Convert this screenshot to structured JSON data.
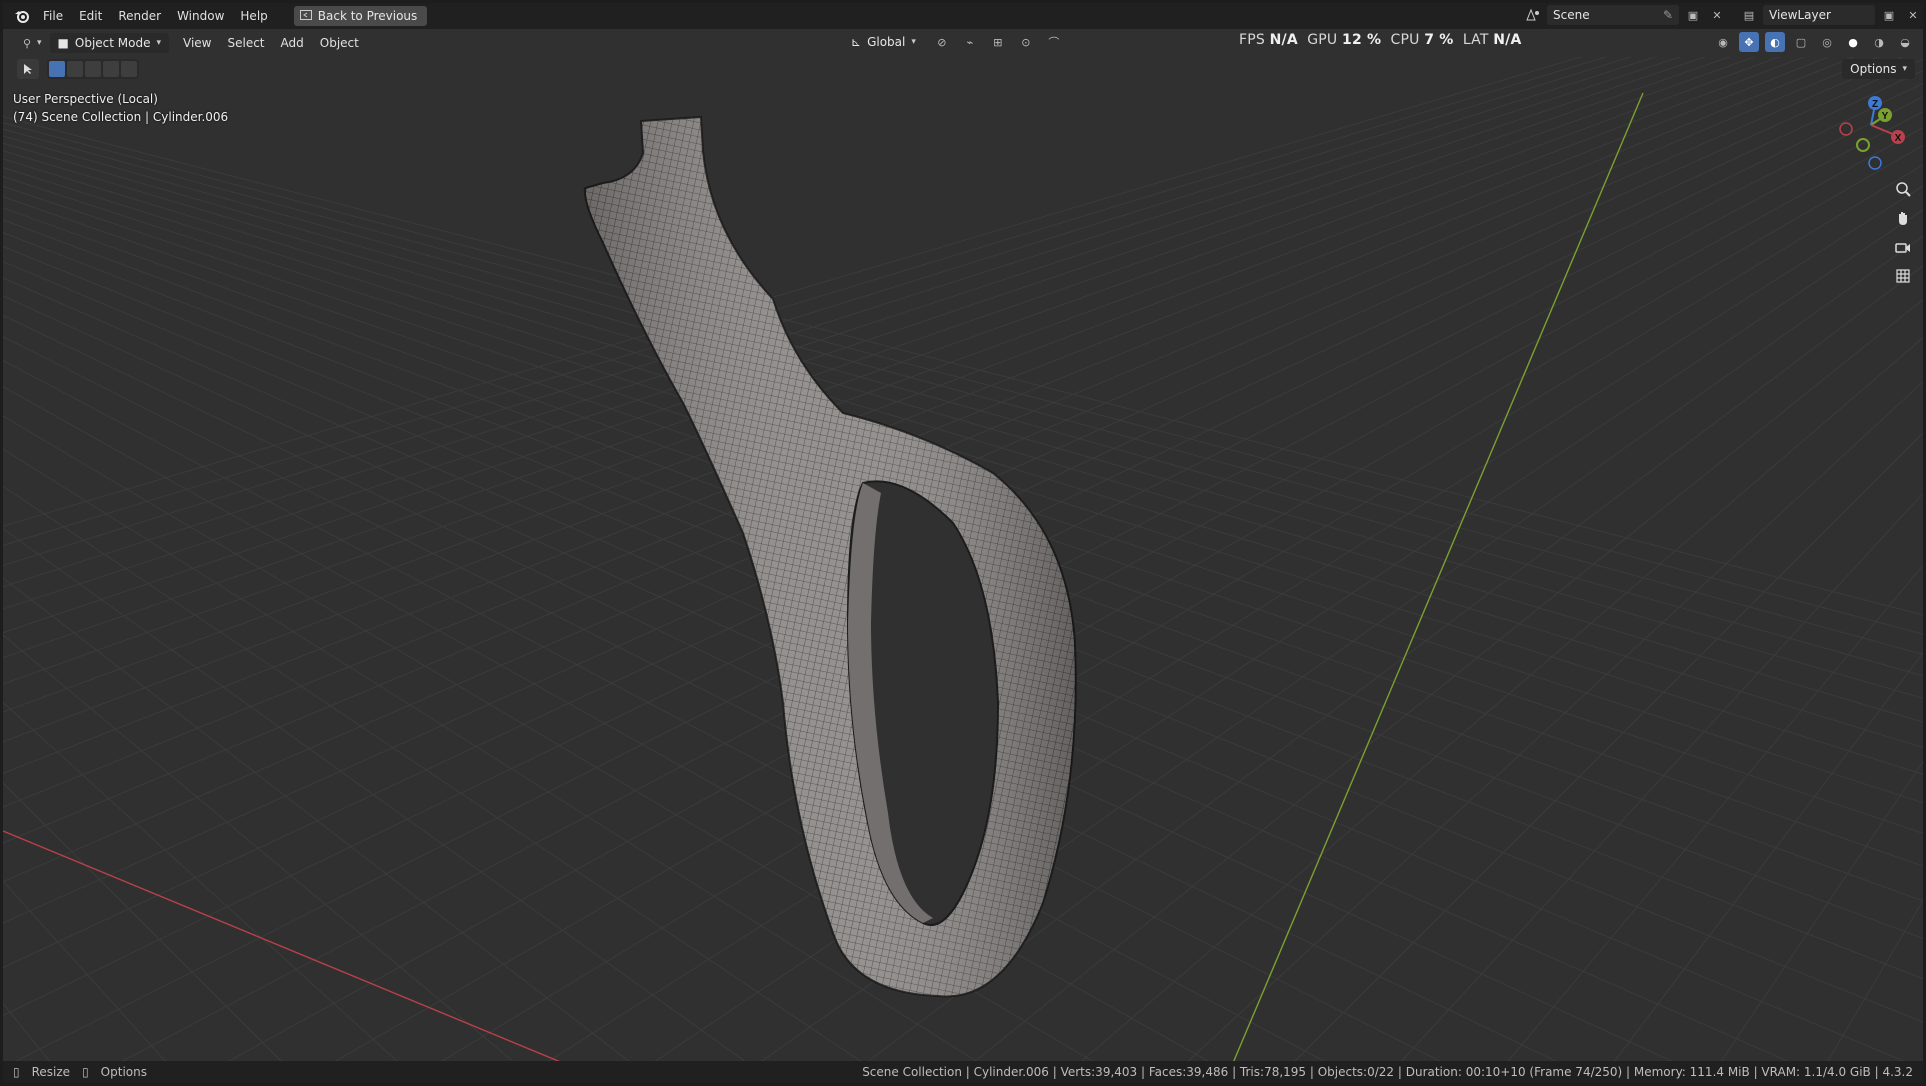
{
  "top_menu": {
    "file": "File",
    "edit": "Edit",
    "render": "Render",
    "window": "Window",
    "help": "Help"
  },
  "back_button": "Back to Previous",
  "scene": {
    "label": "Scene"
  },
  "view_layer": {
    "label": "ViewLayer"
  },
  "viewport_header": {
    "mode": "Object Mode",
    "view": "View",
    "select": "Select",
    "add": "Add",
    "object": "Object",
    "transform_orientation": "Global"
  },
  "stats": {
    "fps_label": "FPS",
    "fps_value": "N/A",
    "gpu_label": "GPU",
    "gpu_value": "12 %",
    "cpu_label": "CPU",
    "cpu_value": "7 %",
    "lat_label": "LAT",
    "lat_value": "N/A"
  },
  "options_label": "Options",
  "viewport_overlay": {
    "perspective": "User Perspective (Local)",
    "collection": "(74) Scene Collection | Cylinder.006"
  },
  "gizmo": {
    "z": "Z",
    "y": "Y",
    "x": "X"
  },
  "status": {
    "resize": "Resize",
    "options": "Options",
    "info": "Scene Collection | Cylinder.006 | Verts:39,403 | Faces:39,486 | Tris:78,195 | Objects:0/22 | Duration: 00:10+10 (Frame 74/250) | Memory: 111.4 MiB | VRAM: 1.1/4.0 GiB | 4.3.2"
  },
  "colors": {
    "x_axis": "#b8414b",
    "y_axis": "#7aa12f",
    "z_axis": "#3c7ad6",
    "viewport_bg": "#303030",
    "mesh": "#8e8a88"
  },
  "icons": [
    "blender-logo-icon",
    "back-icon",
    "scene-icon",
    "pin-icon",
    "viewlayer-icon",
    "mode-icon",
    "orientation-icon",
    "snap-icon",
    "proportional-icon",
    "visibility-icon",
    "gizmo-icon",
    "overlay-icon",
    "xray-icon",
    "shading-wire-icon",
    "shading-solid-icon",
    "shading-material-icon",
    "shading-render-icon",
    "zoom-icon",
    "pan-icon",
    "camera-icon",
    "ortho-grid-icon"
  ]
}
